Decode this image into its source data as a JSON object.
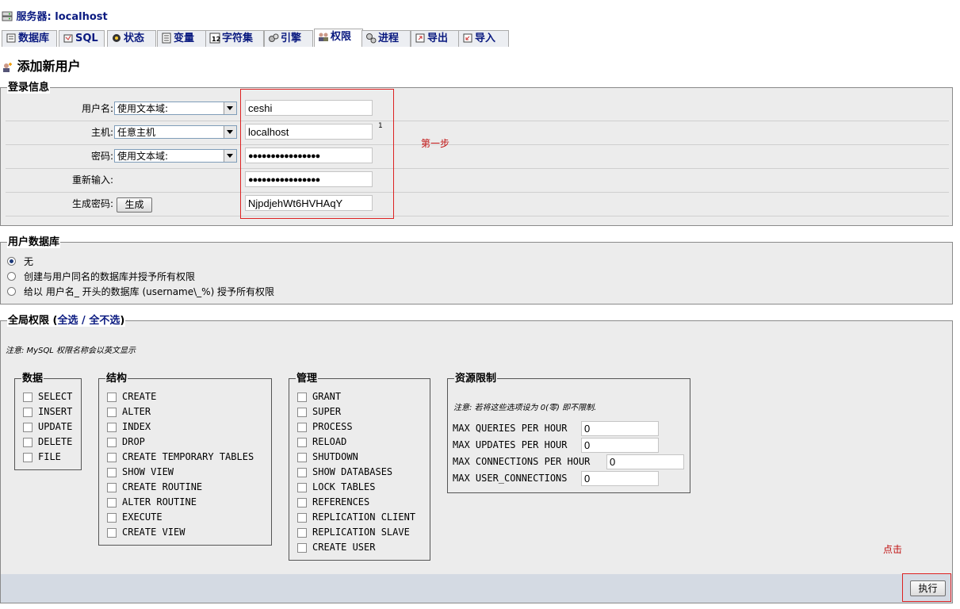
{
  "server": {
    "label": "服务器:",
    "name": "localhost",
    "icon": "server-icon"
  },
  "tabs": [
    {
      "label": "数据库",
      "icon": "database-icon"
    },
    {
      "label": "SQL",
      "icon": "sql-icon"
    },
    {
      "label": "状态",
      "icon": "status-icon"
    },
    {
      "label": "变量",
      "icon": "variables-icon"
    },
    {
      "label": "字符集",
      "icon": "charset-icon"
    },
    {
      "label": "引擎",
      "icon": "engine-icon"
    },
    {
      "label": "权限",
      "icon": "privileges-icon",
      "active": true
    },
    {
      "label": "进程",
      "icon": "process-icon"
    },
    {
      "label": "导出",
      "icon": "export-icon"
    },
    {
      "label": "导入",
      "icon": "import-icon"
    }
  ],
  "page_title": "添加新用户",
  "login": {
    "legend": "登录信息",
    "username": {
      "label": "用户名:",
      "mode": "使用文本域:",
      "value": "ceshi"
    },
    "host": {
      "label": "主机:",
      "mode": "任意主机",
      "value": "localhost",
      "footnote": "1"
    },
    "password": {
      "label": "密码:",
      "mode": "使用文本域:",
      "value": "●●●●●●●●●●●●●●●●"
    },
    "retype": {
      "label": "重新输入:",
      "value": "●●●●●●●●●●●●●●●●"
    },
    "generate": {
      "label": "生成密码:",
      "button": "生成",
      "value": "NjpdjehWt6HVHAqY"
    },
    "annotation": "第一步"
  },
  "userdb": {
    "legend": "用户数据库",
    "options": [
      {
        "label": "无",
        "checked": true
      },
      {
        "label": "创建与用户同名的数据库并授予所有权限",
        "checked": false
      },
      {
        "label": "给以 用户名_ 开头的数据库 (username\\_%) 授予所有权限",
        "checked": false
      }
    ]
  },
  "global": {
    "legend": "全局权限",
    "paren_open": "(",
    "select_all": "全选",
    "sep": " / ",
    "select_none": "全不选",
    "paren_close": ")",
    "note": "注意: MySQL 权限名称会以英文显示",
    "groups": {
      "data": {
        "legend": "数据",
        "items": [
          "SELECT",
          "INSERT",
          "UPDATE",
          "DELETE",
          "FILE"
        ]
      },
      "structure": {
        "legend": "结构",
        "items": [
          "CREATE",
          "ALTER",
          "INDEX",
          "DROP",
          "CREATE TEMPORARY TABLES",
          "SHOW VIEW",
          "CREATE ROUTINE",
          "ALTER ROUTINE",
          "EXECUTE",
          "CREATE VIEW"
        ]
      },
      "admin": {
        "legend": "管理",
        "items": [
          "GRANT",
          "SUPER",
          "PROCESS",
          "RELOAD",
          "SHUTDOWN",
          "SHOW DATABASES",
          "LOCK TABLES",
          "REFERENCES",
          "REPLICATION CLIENT",
          "REPLICATION SLAVE",
          "CREATE USER"
        ]
      },
      "limits": {
        "legend": "资源限制",
        "note": "注意: 若将这些选项设为 0(零) 即不限制.",
        "rows": [
          {
            "label": "MAX QUERIES PER HOUR",
            "value": "0"
          },
          {
            "label": "MAX UPDATES PER HOUR",
            "value": "0"
          },
          {
            "label": "MAX CONNECTIONS PER HOUR",
            "value": "0"
          },
          {
            "label": "MAX USER_CONNECTIONS",
            "value": "0"
          }
        ]
      }
    }
  },
  "footer": {
    "annotation": "点击",
    "go_button": "执行"
  }
}
